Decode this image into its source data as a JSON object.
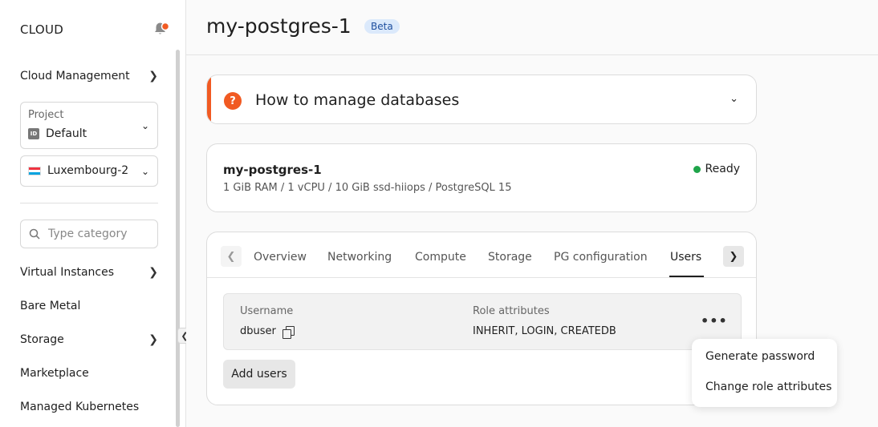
{
  "sidebar": {
    "brand": "CLOUD",
    "cloud_management": "Cloud Management",
    "project": {
      "label": "Project",
      "value": "Default",
      "badge": "ID"
    },
    "region": {
      "value": "Luxembourg-2"
    },
    "search": {
      "placeholder": "Type category"
    },
    "nav": [
      {
        "label": "Virtual Instances"
      },
      {
        "label": "Bare Metal"
      },
      {
        "label": "Storage"
      },
      {
        "label": "Marketplace"
      },
      {
        "label": "Managed Kubernetes"
      }
    ]
  },
  "header": {
    "title": "my-postgres-1",
    "badge": "Beta"
  },
  "howto": {
    "icon": "?",
    "title": "How to manage databases"
  },
  "database": {
    "name": "my-postgres-1",
    "spec": "1 GiB RAM / 1 vCPU / 10 GiB ssd-hiiops / PostgreSQL 15",
    "status": "Ready",
    "status_color": "#1fa44a"
  },
  "tabs": [
    {
      "label": "Overview"
    },
    {
      "label": "Networking"
    },
    {
      "label": "Compute"
    },
    {
      "label": "Storage"
    },
    {
      "label": "PG configuration"
    },
    {
      "label": "Users"
    }
  ],
  "users_table": {
    "headers": {
      "username": "Username",
      "role_attributes": "Role attributes"
    },
    "rows": [
      {
        "username": "dbuser",
        "role_attributes": "INHERIT, LOGIN, CREATEDB"
      }
    ]
  },
  "add_users_label": "Add users",
  "context_menu": {
    "items": [
      {
        "label": "Generate password"
      },
      {
        "label": "Change role attributes"
      }
    ]
  },
  "colors": {
    "accent": "#f15a22",
    "beta_bg": "#dbe9fb"
  }
}
